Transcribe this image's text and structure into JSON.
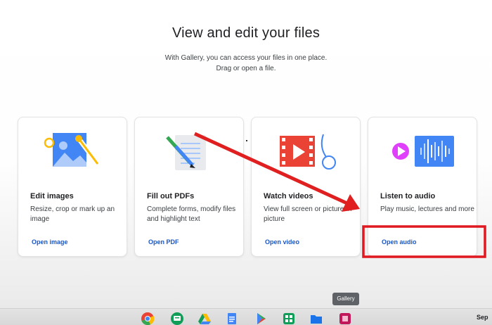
{
  "header": {
    "title": "View and edit your files",
    "subtitle_line1": "With Gallery, you can access your files in one place.",
    "subtitle_line2": "Drag or open a file."
  },
  "cards": [
    {
      "title": "Edit images",
      "description": "Resize, crop or mark up an image",
      "link": "Open image",
      "icon": "image-edit-icon"
    },
    {
      "title": "Fill out PDFs",
      "description": "Complete forms, modify files and highlight text",
      "link": "Open PDF",
      "icon": "pdf-document-icon"
    },
    {
      "title": "Watch videos",
      "description": "View full screen or picture-in-picture",
      "link": "Open video",
      "icon": "video-icon"
    },
    {
      "title": "Listen to audio",
      "description": "Play music, lectures and more",
      "link": "Open audio",
      "icon": "audio-icon"
    }
  ],
  "shelf": {
    "tooltip": "Gallery",
    "clock": "Sep",
    "apps": [
      "chrome-icon",
      "messages-icon",
      "drive-icon",
      "docs-icon",
      "play-store-icon",
      "app-grid-icon",
      "files-icon",
      "gallery-icon"
    ]
  },
  "annotation_colors": {
    "arrow": "#e02020",
    "highlight_box": "#e0181f"
  }
}
